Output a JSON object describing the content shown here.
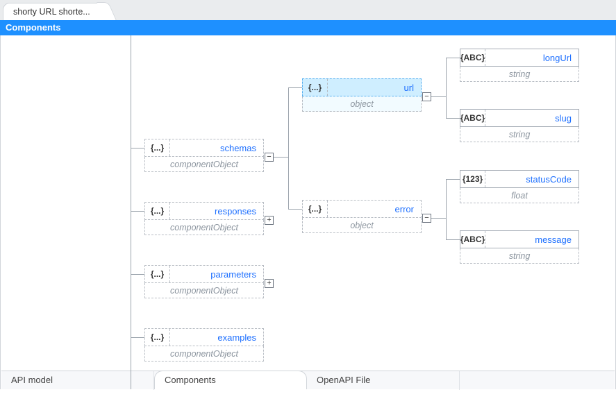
{
  "file_tab": "shorty URL shorte...",
  "header": "Components",
  "icons": {
    "object": "{...}",
    "string": "{ABC}",
    "number": "{123}"
  },
  "nodes": {
    "schemas": {
      "name": "schemas",
      "type": "componentObject"
    },
    "responses": {
      "name": "responses",
      "type": "componentObject"
    },
    "parameters": {
      "name": "parameters",
      "type": "componentObject"
    },
    "examples": {
      "name": "examples",
      "type": "componentObject"
    },
    "url": {
      "name": "url",
      "type": "object"
    },
    "error": {
      "name": "error",
      "type": "object"
    },
    "longUrl": {
      "name": "longUrl",
      "type": "string"
    },
    "slug": {
      "name": "slug",
      "type": "string"
    },
    "statusCode": {
      "name": "statusCode",
      "type": "float"
    },
    "message": {
      "name": "message",
      "type": "string"
    }
  },
  "bottom_tabs": {
    "api_model": "API model",
    "components": "Components",
    "openapi_file": "OpenAPI File"
  }
}
